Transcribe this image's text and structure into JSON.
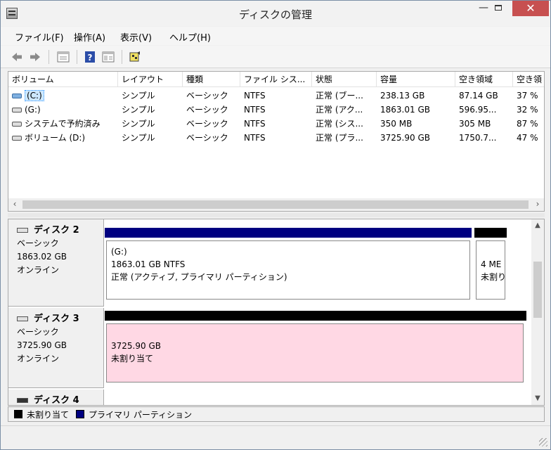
{
  "window": {
    "title": "ディスクの管理",
    "minimize": "—",
    "close": "✕"
  },
  "menu": [
    "ファイル(F)",
    "操作(A)",
    "表示(V)",
    "ヘルプ(H)"
  ],
  "toolbar": {
    "icons": [
      "back-icon",
      "forward-icon",
      "properties-icon",
      "help-icon",
      "view-icon",
      "settings-icon"
    ]
  },
  "volume_table": {
    "columns": [
      "ボリューム",
      "レイアウト",
      "種類",
      "ファイル シス...",
      "状態",
      "容量",
      "空き領域",
      "空き領"
    ],
    "rows": [
      {
        "name": "(C:)",
        "layout": "シンプル",
        "type": "ベーシック",
        "fs": "NTFS",
        "status": "正常 (ブー...",
        "capacity": "238.13 GB",
        "free": "87.14 GB",
        "pct": "37 %"
      },
      {
        "name": "(G:)",
        "layout": "シンプル",
        "type": "ベーシック",
        "fs": "NTFS",
        "status": "正常 (アク...",
        "capacity": "1863.01 GB",
        "free": "596.95...",
        "pct": "32 %"
      },
      {
        "name": "システムで予約済み",
        "layout": "シンプル",
        "type": "ベーシック",
        "fs": "NTFS",
        "status": "正常 (シス...",
        "capacity": "350 MB",
        "free": "305 MB",
        "pct": "87 %"
      },
      {
        "name": "ボリューム (D:)",
        "layout": "シンプル",
        "type": "ベーシック",
        "fs": "NTFS",
        "status": "正常 (プラ...",
        "capacity": "3725.90 GB",
        "free": "1750.7...",
        "pct": "47 %"
      }
    ]
  },
  "disks": [
    {
      "name": "ディスク 2",
      "type": "ベーシック",
      "size": "1863.02 GB",
      "status": "オンライン",
      "partitions": [
        {
          "line1": "(G:)",
          "line2": "1863.01 GB NTFS",
          "line3": "正常 (アクティブ, プライマリ パーティション)"
        },
        {
          "line1": "4 ME",
          "line2": "未割り"
        }
      ]
    },
    {
      "name": "ディスク 3",
      "type": "ベーシック",
      "size": "3725.90 GB",
      "status": "オンライン",
      "partitions": [
        {
          "line1": "3725.90 GB",
          "line2": "未割り当て"
        }
      ]
    },
    {
      "name": "ディスク 4"
    }
  ],
  "legend": [
    {
      "label": "未割り当て",
      "color": "#000000"
    },
    {
      "label": "プライマリ パーティション",
      "color": "#000080"
    }
  ],
  "colors": {
    "primary": "#000080",
    "unallocated": "#000000",
    "unallocated_fill": "#ffd8e4",
    "selection": "#cde8ff",
    "close": "#c75050"
  }
}
